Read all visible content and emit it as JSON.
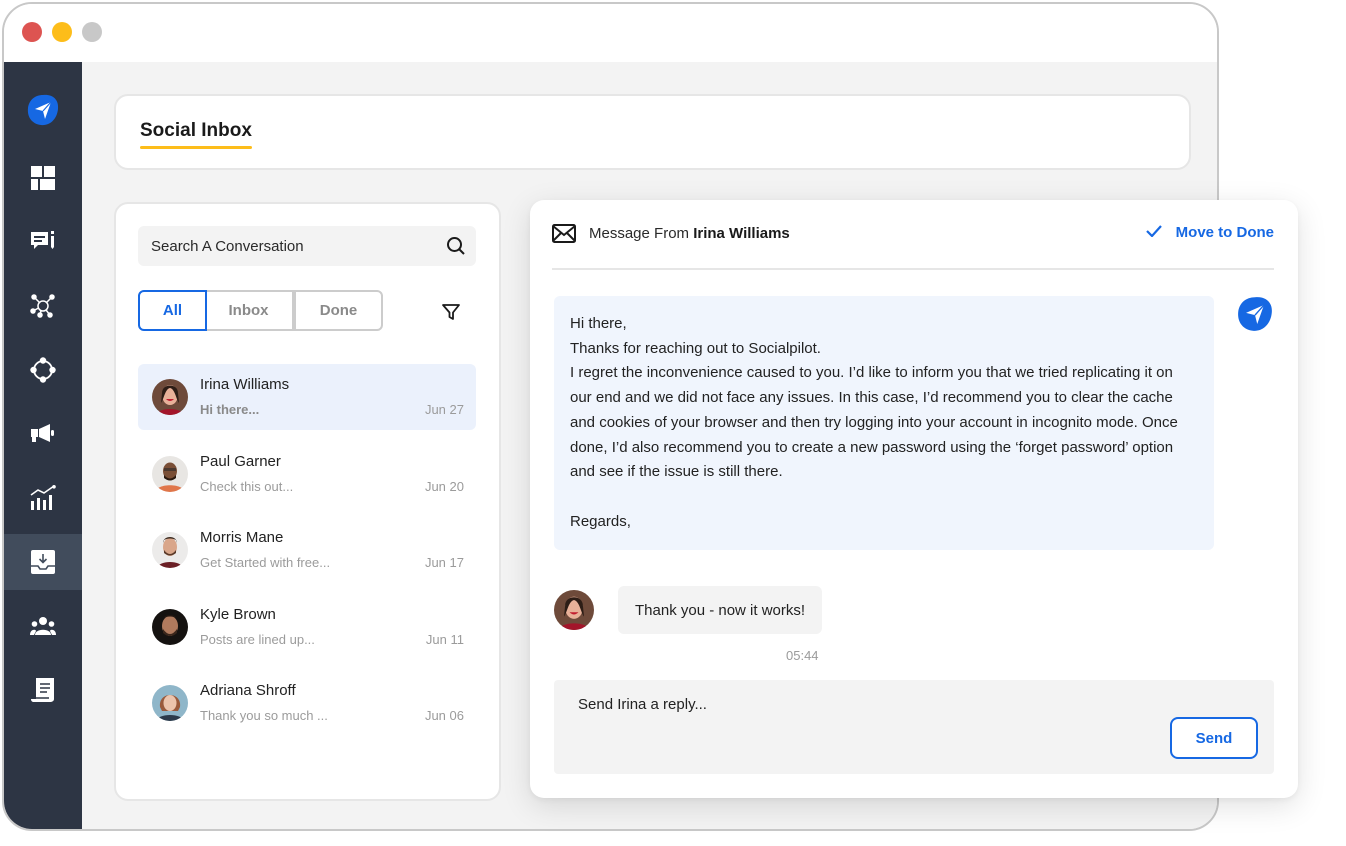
{
  "window": {
    "controls": [
      "close",
      "minimize",
      "maximize"
    ]
  },
  "sidebar": {
    "items": [
      {
        "name": "brand-logo",
        "icon": "paper-plane-icon"
      },
      {
        "name": "dashboard",
        "icon": "dashboard-icon"
      },
      {
        "name": "posts",
        "icon": "compose-icon"
      },
      {
        "name": "connections",
        "icon": "network-icon"
      },
      {
        "name": "integrations",
        "icon": "nodes-icon"
      },
      {
        "name": "campaigns",
        "icon": "megaphone-icon"
      },
      {
        "name": "analytics",
        "icon": "analytics-icon"
      },
      {
        "name": "social-inbox",
        "icon": "inbox-icon",
        "active": true
      },
      {
        "name": "team",
        "icon": "team-icon"
      },
      {
        "name": "reports",
        "icon": "document-icon"
      }
    ]
  },
  "header": {
    "title": "Social Inbox",
    "accent": "#fdbd1a"
  },
  "conversations_panel": {
    "search_placeholder": "Search A Conversation",
    "tabs": [
      {
        "label": "All",
        "active": true
      },
      {
        "label": "Inbox",
        "active": false
      },
      {
        "label": "Done",
        "active": false
      }
    ],
    "items": [
      {
        "name": "Irina Williams",
        "preview": "Hi there...",
        "date": "Jun 27",
        "active": true
      },
      {
        "name": "Paul Garner",
        "preview": "Check this out...",
        "date": "Jun 20"
      },
      {
        "name": "Morris Mane",
        "preview": "Get Started with free...",
        "date": "Jun 17"
      },
      {
        "name": "Kyle Brown",
        "preview": "Posts are lined up...",
        "date": "Jun 11"
      },
      {
        "name": "Adriana Shroff",
        "preview": "Thank you so much ...",
        "date": "Jun 06"
      }
    ]
  },
  "message_panel": {
    "from_prefix": "Message From",
    "from_name": "Irina Williams",
    "move_to_done": "Move to Done",
    "outgoing": {
      "lines": [
        "Hi there,",
        "Thanks for reaching out to Socialpilot.",
        "I regret the inconvenience caused to you. I’d like to inform you that we tried replicating it on our end and we did not face any issues. In this case, I’d recommend you to clear the cache and cookies of your browser and then try logging into your account in incognito mode. Once done, I’d also recommend you to create a new password using the ‘forget password’ option and see if the issue is still there.",
        "Regards,"
      ]
    },
    "incoming": {
      "text": "Thank you - now it works!",
      "time": "05:44"
    },
    "reply_placeholder": "Send Irina a reply...",
    "send_label": "Send"
  },
  "colors": {
    "primary": "#1668e3",
    "sidebar": "#2d3544",
    "sidebar_active": "#414c5c",
    "accent": "#fdbd1a"
  }
}
